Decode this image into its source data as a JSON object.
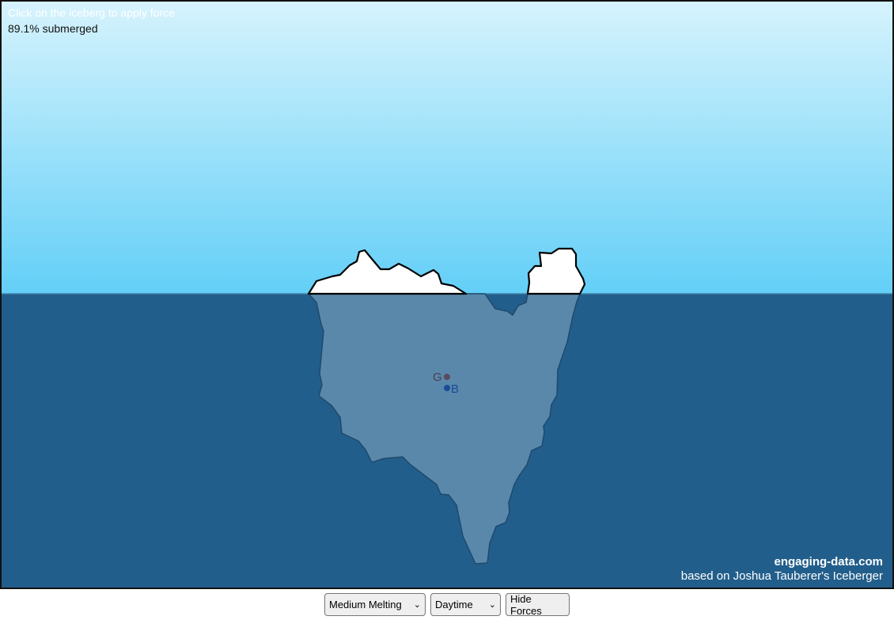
{
  "scene": {
    "hint": "Click on the iceberg to apply force",
    "status": "89.1% submerged",
    "gravity_label": "G",
    "buoyancy_label": "B"
  },
  "credits": {
    "site": "engaging-data.com",
    "based_on": "based on Joshua Tauberer's Iceberger"
  },
  "controls": {
    "melting_selected": "Medium Melting",
    "time_selected": "Daytime",
    "forces_button": "Hide Forces"
  },
  "colors": {
    "sky_top": "#d6f3fd",
    "sky_bottom": "#63cff7",
    "water": "#225e8b",
    "ice_above": "#ffffff",
    "ice_below": "#5a88aa",
    "gravity_dot": "#5b4a5e",
    "buoyancy_dot": "#1c4b99"
  }
}
